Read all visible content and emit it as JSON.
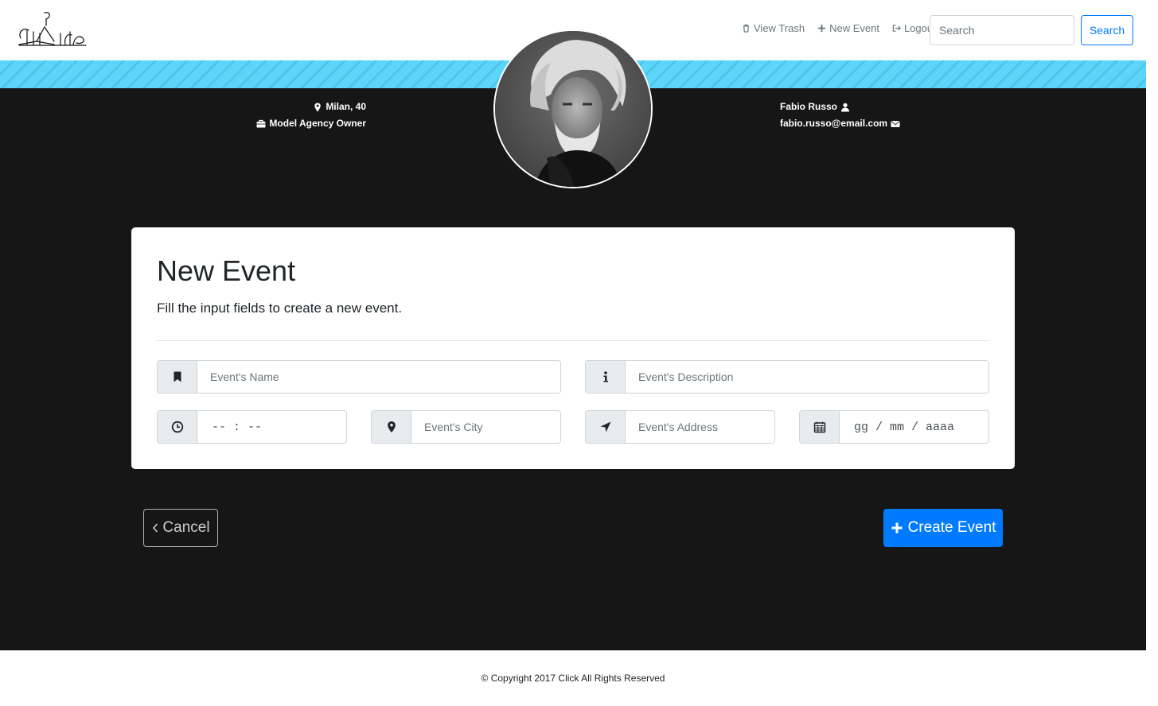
{
  "brand": {
    "logo_text": "Click"
  },
  "nav": {
    "view_trash": "View Trash",
    "new_event": "New Event",
    "logout": "Logout",
    "search_placeholder": "Search",
    "search_button": "Search"
  },
  "profile": {
    "location": "Milan, 40",
    "occupation": "Model Agency Owner",
    "name": "Fabio Russo",
    "email": "fabio.russo@email.com"
  },
  "form": {
    "title": "New Event",
    "subtitle": "Fill the input fields to create a new event.",
    "name_placeholder": "Event's Name",
    "description_placeholder": "Event's Description",
    "time_placeholder": "-- : --",
    "city_placeholder": "Event's City",
    "address_placeholder": "Event's Address",
    "date_placeholder": "gg / mm / aaaa"
  },
  "actions": {
    "cancel": "Cancel",
    "create": "Create Event"
  },
  "footer": {
    "copyright": "© Copyright 2017 Click All Rights Reserved"
  },
  "colors": {
    "accent": "#007bff",
    "stripe": "#5bd5f8",
    "dark_bg": "#161616"
  }
}
